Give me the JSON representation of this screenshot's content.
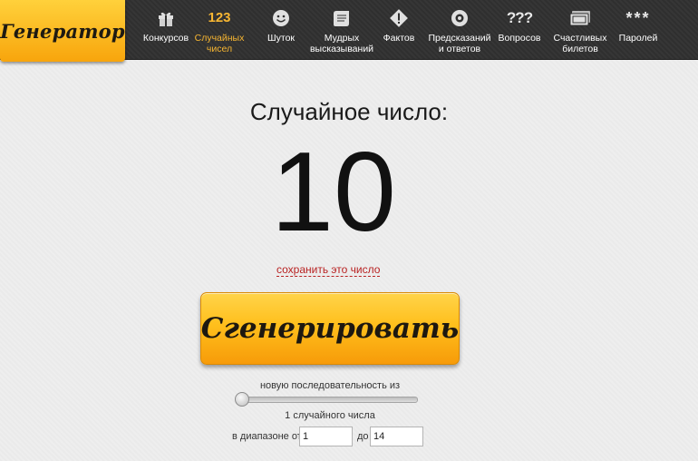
{
  "logo": "Генератор",
  "nav": [
    {
      "icon": "gift-icon",
      "label1": "Конкурсов",
      "label2": ""
    },
    {
      "icon": "number-icon",
      "icon_text": "123",
      "label1": "Случайных",
      "label2": "чисел",
      "active": true
    },
    {
      "icon": "smile-icon",
      "label1": "Шуток",
      "label2": ""
    },
    {
      "icon": "scroll-icon",
      "label1": "Мудрых",
      "label2": "высказываний"
    },
    {
      "icon": "warning-icon",
      "label1": "Фактов",
      "label2": ""
    },
    {
      "icon": "eight-ball-icon",
      "label1": "Предсказаний",
      "label2": "и ответов"
    },
    {
      "icon": "question-icon",
      "icon_text": "???",
      "label1": "Вопросов",
      "label2": ""
    },
    {
      "icon": "ticket-icon",
      "label1": "Счастливых",
      "label2": "билетов"
    },
    {
      "icon": "password-icon",
      "icon_text": "***",
      "label1": "Паролей",
      "label2": ""
    }
  ],
  "main": {
    "heading": "Случайное число:",
    "number": "10",
    "save_link": "сохранить это число",
    "generate_button": "Сгенерировать",
    "sequence_label": "новую последовательность из",
    "count_label": "1 случайного числа",
    "slider_value": 1,
    "range_from_label": "в диапазоне от",
    "range_from": "1",
    "range_to_label": "до",
    "range_to": "14"
  },
  "colors": {
    "accent": "#f7b632",
    "nav_bg": "#2f2f2f",
    "link": "#b82222"
  }
}
